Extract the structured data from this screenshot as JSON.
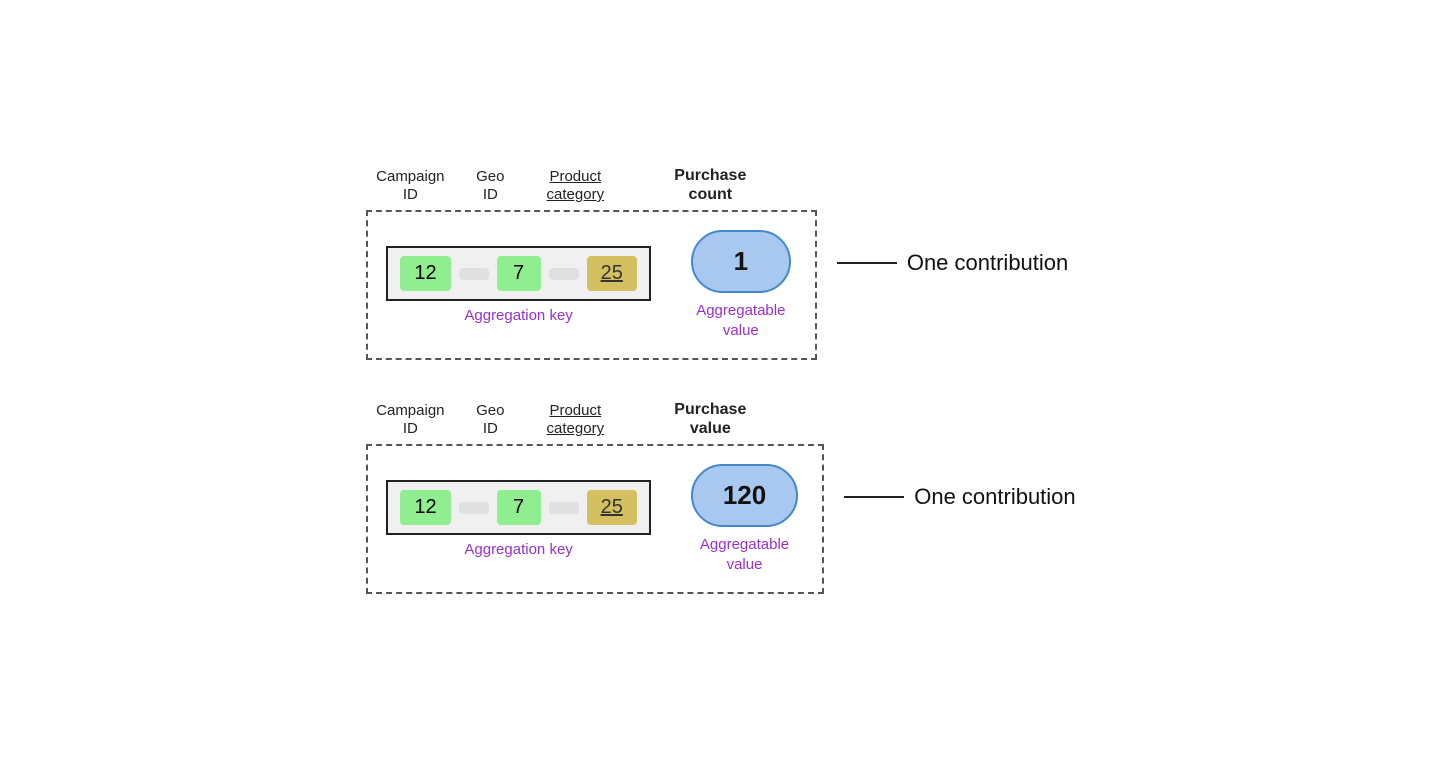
{
  "blocks": [
    {
      "id": "block1",
      "columns": {
        "campaign": "Campaign\nID",
        "geo": "Geo\nID",
        "product": "Product\ncategory",
        "purchase_label": "Purchase\ncount"
      },
      "key_cells": [
        {
          "value": "12",
          "type": "green"
        },
        {
          "value": "7",
          "type": "green"
        },
        {
          "value": "25",
          "type": "yellow"
        }
      ],
      "agg_key_label": "Aggregation key",
      "value": "1",
      "agg_value_label": "Aggregatable\nvalue",
      "contribution_label": "One contribution"
    },
    {
      "id": "block2",
      "columns": {
        "campaign": "Campaign\nID",
        "geo": "Geo\nID",
        "product": "Product\ncategory",
        "purchase_label": "Purchase\nvalue"
      },
      "key_cells": [
        {
          "value": "12",
          "type": "green"
        },
        {
          "value": "7",
          "type": "green"
        },
        {
          "value": "25",
          "type": "yellow"
        }
      ],
      "agg_key_label": "Aggregation key",
      "value": "120",
      "agg_value_label": "Aggregatable\nvalue",
      "contribution_label": "One contribution"
    }
  ]
}
